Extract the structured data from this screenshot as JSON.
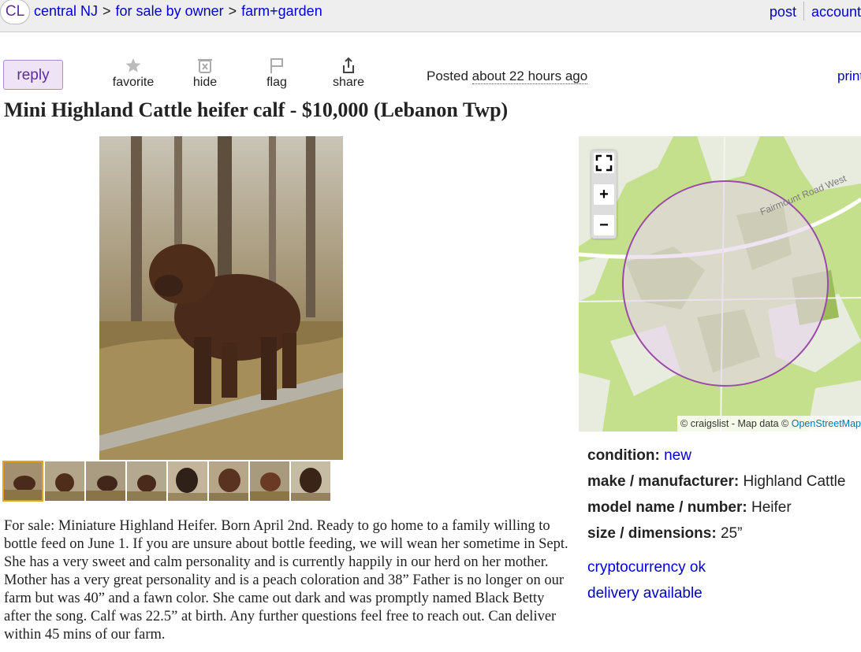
{
  "header": {
    "logo": "CL",
    "breadcrumbs": [
      "central NJ",
      "for sale by owner",
      "farm+garden"
    ],
    "separator": ">",
    "links": [
      "post",
      "account"
    ]
  },
  "actions": {
    "reply": "reply",
    "favorite": "favorite",
    "hide": "hide",
    "flag": "flag",
    "share": "share"
  },
  "posted": {
    "label": "Posted",
    "time": "about 22 hours ago"
  },
  "print": "print",
  "listing": {
    "title": "Mini Highland Cattle heifer calf - $10,000 (Lebanon Twp)",
    "thumbnail_count": 8,
    "body": "For sale: Miniature Highland Heifer. Born April 2nd. Ready to go home to a family willing to bottle feed on June 1. If you are unsure about bottle feeding, we will wean her sometime in Sept. She has a very sweet and calm personality and is currently happily in our herd on her mother. Mother has a very great personality and is a peach coloration and 38” Father is no longer on our farm but was 40” and a fawn color. She came out dark and was promptly named Black Betty after the song. Calf was 22.5” at birth. Any further questions feel free to reach out. Can deliver within 45 mins of our farm."
  },
  "map": {
    "zoom_in": "+",
    "zoom_out": "−",
    "road_label": "Fairmount Road West",
    "attribution_prefix": "© craigslist - Map data ©",
    "attribution_link": "OpenStreetMap",
    "colors": {
      "land": "#c5e08c",
      "forest": "#9dbd5a",
      "circle_fill": "#e6d6ea",
      "circle_stroke": "#9b4ba8",
      "road": "#ffffff"
    }
  },
  "attributes": [
    {
      "label": "condition:",
      "value": "new",
      "is_link": true
    },
    {
      "label": "make / manufacturer:",
      "value": "Highland Cattle",
      "is_link": false
    },
    {
      "label": "model name / number:",
      "value": "Heifer",
      "is_link": false
    },
    {
      "label": "size / dimensions:",
      "value": "25”",
      "is_link": false
    }
  ],
  "flags": [
    "cryptocurrency ok",
    "delivery available"
  ],
  "colors": {
    "link": "#0000cc",
    "reply_bg": "#eee3f7",
    "reply_text": "#5b2e99",
    "thumb_selected": "#e6a321"
  }
}
